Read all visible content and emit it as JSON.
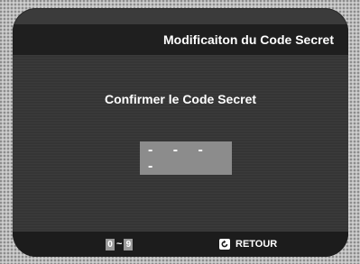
{
  "header": {
    "title": "Modificaiton du Code Secret"
  },
  "main": {
    "prompt": "Confirmer le Code Secret",
    "code_placeholder": "- - - -"
  },
  "footer": {
    "key_start": "0",
    "key_separator": "~",
    "key_end": "9",
    "return_icon": "return-arrow-icon",
    "return_label": "RETOUR"
  },
  "colors": {
    "screen_background": "#3b3b3b",
    "header_background": "#1f1f1f",
    "footer_background": "#1c1c1c",
    "code_box": "#8c8c8c",
    "text": "#ffffff"
  }
}
